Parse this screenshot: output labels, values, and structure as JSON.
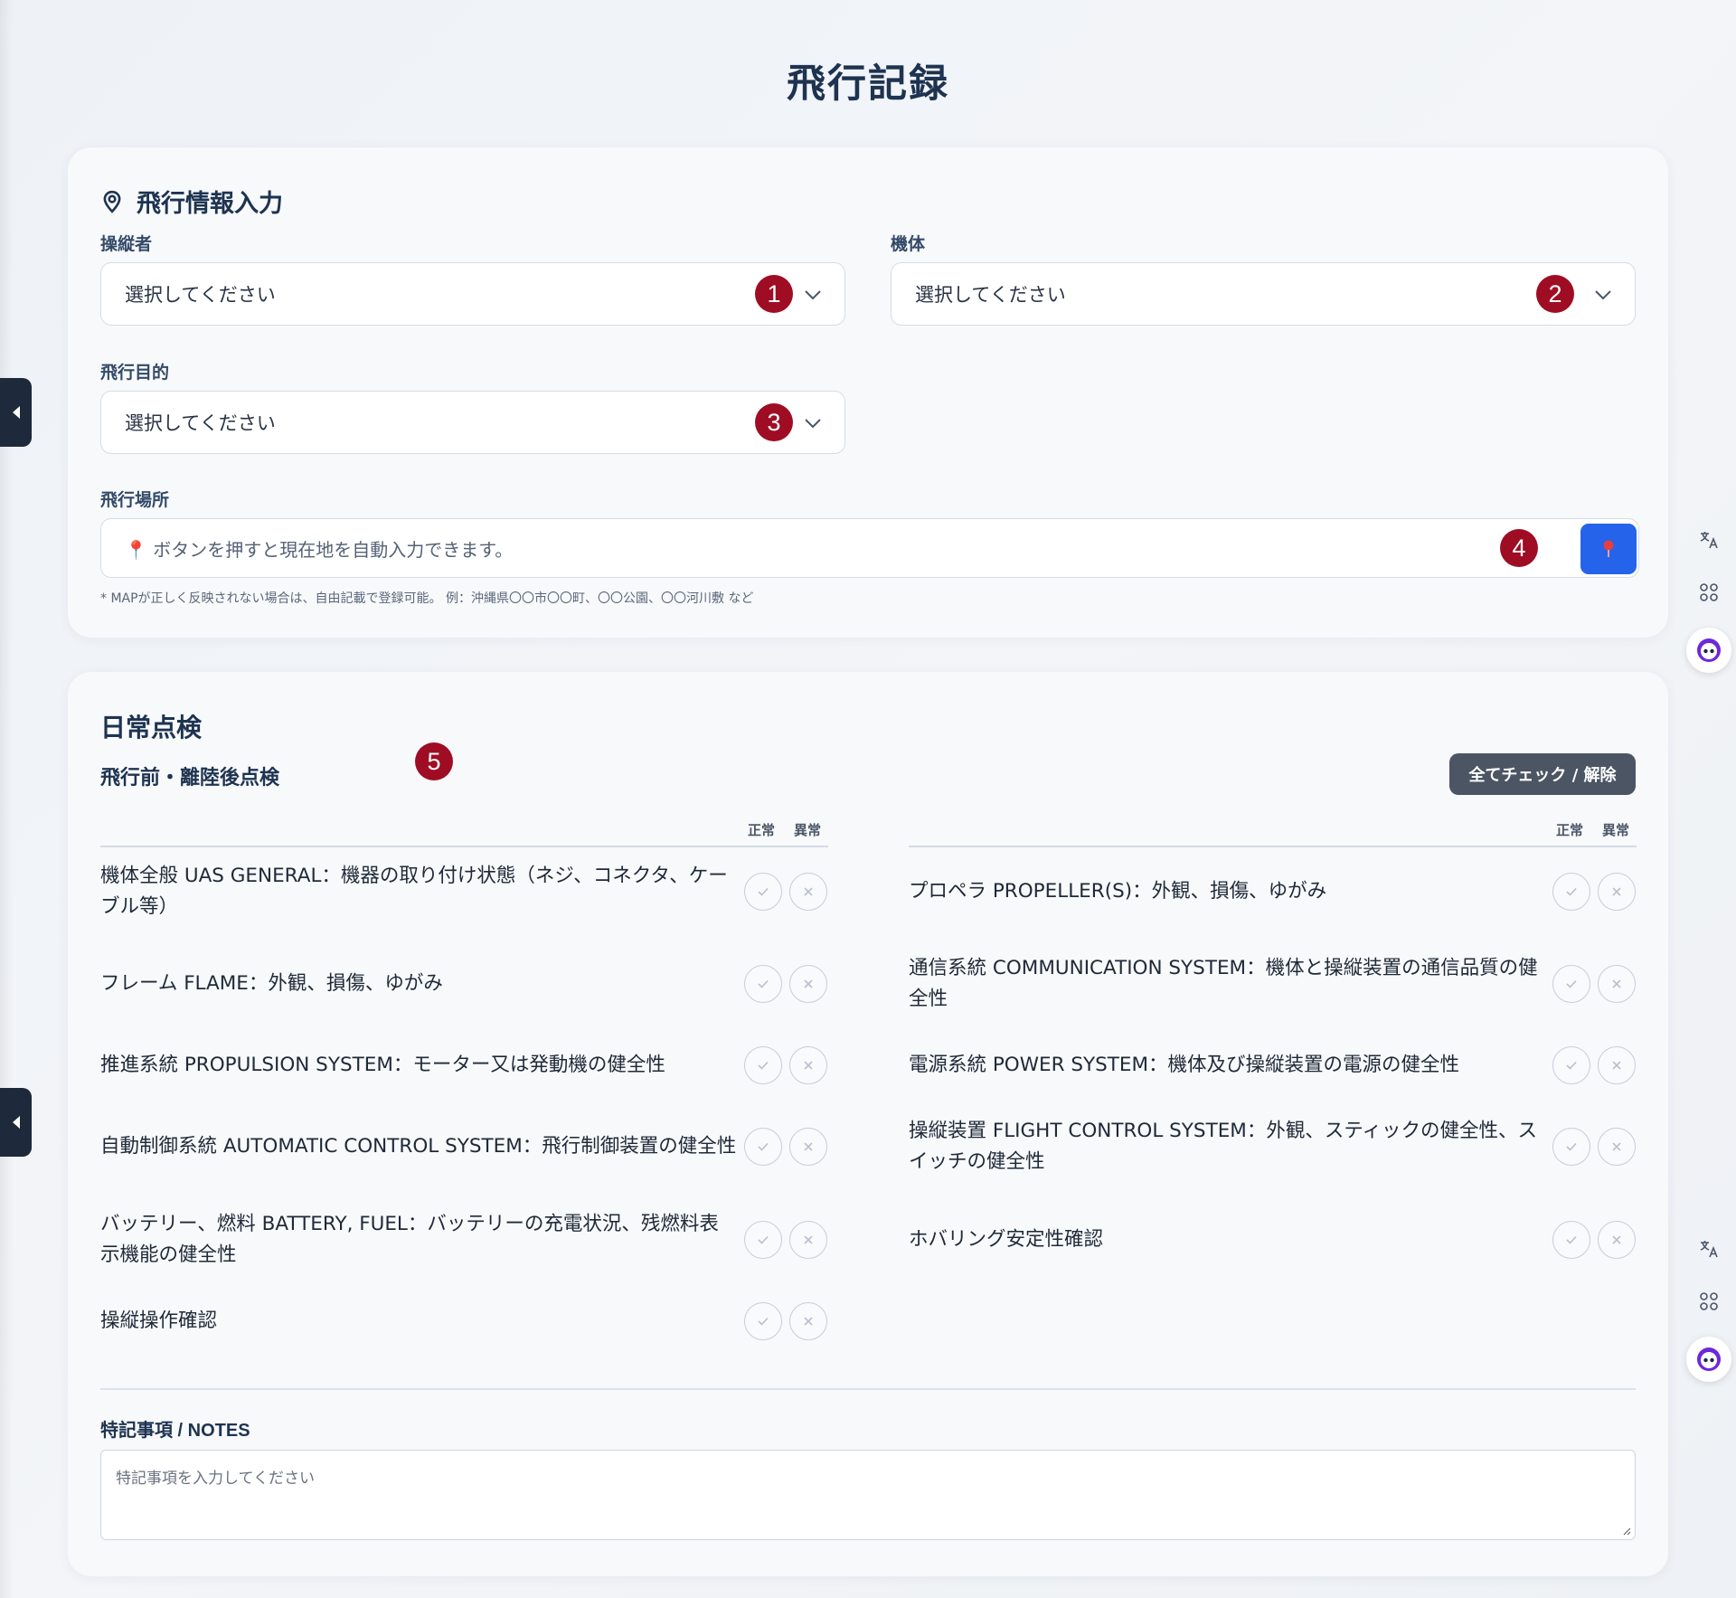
{
  "page": {
    "title": "飛行記録"
  },
  "flight_info": {
    "title": "飛行情報入力",
    "pilot": {
      "label": "操縦者",
      "value": "選択してください",
      "badge": "1"
    },
    "aircraft": {
      "label": "機体",
      "value": "選択してください",
      "badge": "2"
    },
    "purpose": {
      "label": "飛行目的",
      "value": "選択してください",
      "badge": "3"
    },
    "location": {
      "label": "飛行場所",
      "placeholder": "📍 ボタンを押すと現在地を自動入力できます。",
      "badge": "4",
      "button_icon": "map-pin-icon",
      "hint": "* MAPが正しく反映されない場合は、自由記載で登録可能。 例：沖縄県〇〇市〇〇町、〇〇公園、〇〇河川敷 など"
    }
  },
  "inspection": {
    "title": "日常点検",
    "subtitle": "飛行前・離陸後点検",
    "badge": "5",
    "check_all_label": "全てチェック / 解除",
    "col_normal": "正常",
    "col_abnormal": "異常",
    "left_items": [
      {
        "text": "機体全般 UAS GENERAL：機器の取り付け状態（ネジ、コネクタ、ケーブル等）"
      },
      {
        "text": "フレーム FLAME：外観、損傷、ゆがみ"
      },
      {
        "text": "推進系統 PROPULSION SYSTEM：モーター又は発動機の健全性"
      },
      {
        "text": "自動制御系統 AUTOMATIC CONTROL SYSTEM：飛行制御装置の健全性"
      },
      {
        "text": "バッテリー、燃料 BATTERY, FUEL：バッテリーの充電状況、残燃料表示機能の健全性"
      },
      {
        "text": "操縦操作確認"
      }
    ],
    "right_items": [
      {
        "text": "プロペラ PROPELLER(S)：外観、損傷、ゆがみ"
      },
      {
        "text": "通信系統 COMMUNICATION SYSTEM：機体と操縦装置の通信品質の健全性"
      },
      {
        "text": "電源系統 POWER SYSTEM：機体及び操縦装置の電源の健全性"
      },
      {
        "text": "操縦装置 FLIGHT CONTROL SYSTEM：外観、スティックの健全性、スイッチの健全性"
      },
      {
        "text": "ホバリング安定性確認"
      }
    ],
    "notes_label": "特記事項 / NOTES",
    "notes_placeholder": "特記事項を入力してください"
  },
  "colors": {
    "accent": "#2563eb",
    "badge": "#9f0d24",
    "title": "#1e3350",
    "dark_button": "#4b5563"
  }
}
